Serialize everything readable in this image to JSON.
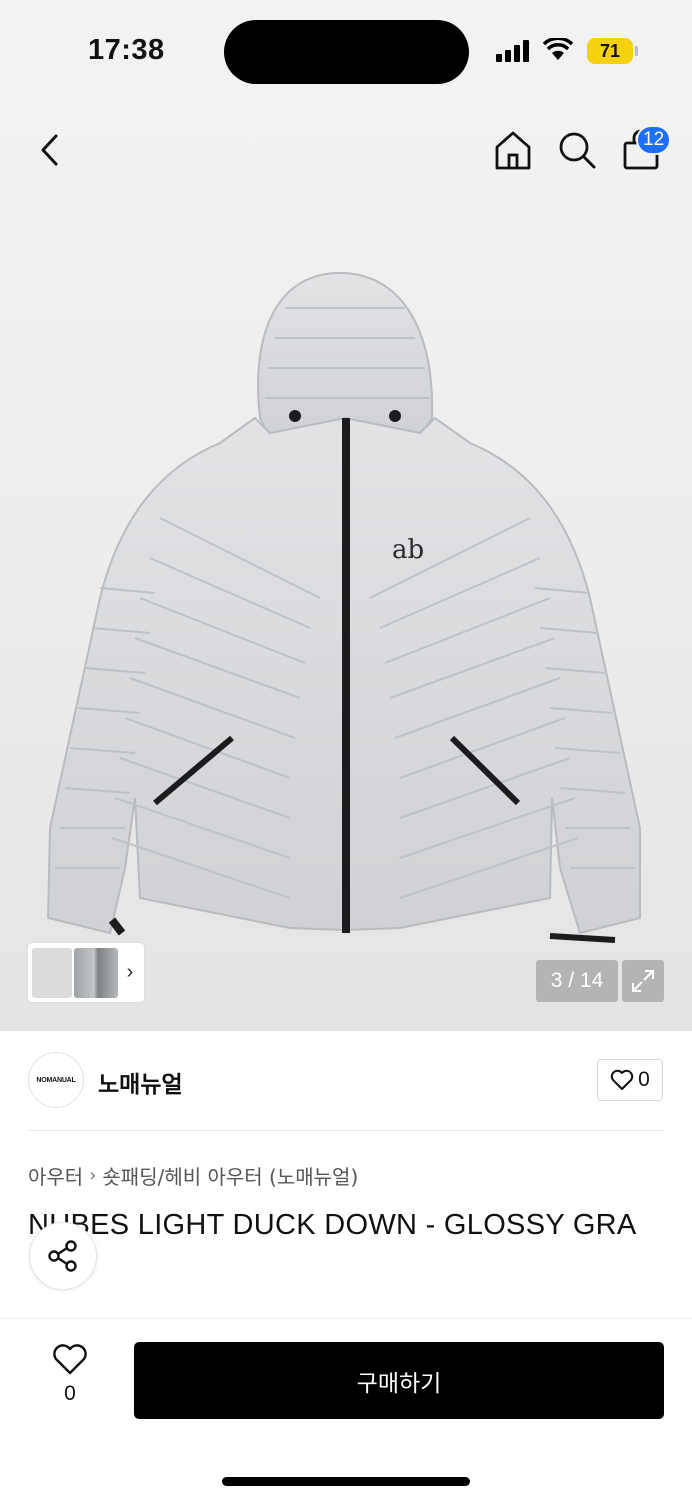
{
  "status_bar": {
    "time": "17:38",
    "battery": "71"
  },
  "header": {
    "cart_count": "12"
  },
  "gallery": {
    "counter": "3 / 14"
  },
  "brand": {
    "logo_text": "NOMANUAL",
    "name": "노매뉴얼",
    "like_count": "0"
  },
  "breadcrumb": {
    "category": "아우터",
    "subcategory": "숏패딩/헤비 아우터 (노매뉴얼)"
  },
  "product": {
    "title": "NUBES LIGHT DUCK DOWN - GLOSSY GRA"
  },
  "bottom_bar": {
    "wish_count": "0",
    "buy_label": "구매하기"
  },
  "icons": {
    "back": "chevron-left-icon",
    "home": "home-icon",
    "search": "search-icon",
    "cart": "shopping-bag-icon",
    "expand": "expand-icon",
    "heart": "heart-icon",
    "share": "share-icon"
  },
  "colors": {
    "badge": "#1f6fff",
    "buy_button": "#000000",
    "battery": "#f5d20d"
  }
}
